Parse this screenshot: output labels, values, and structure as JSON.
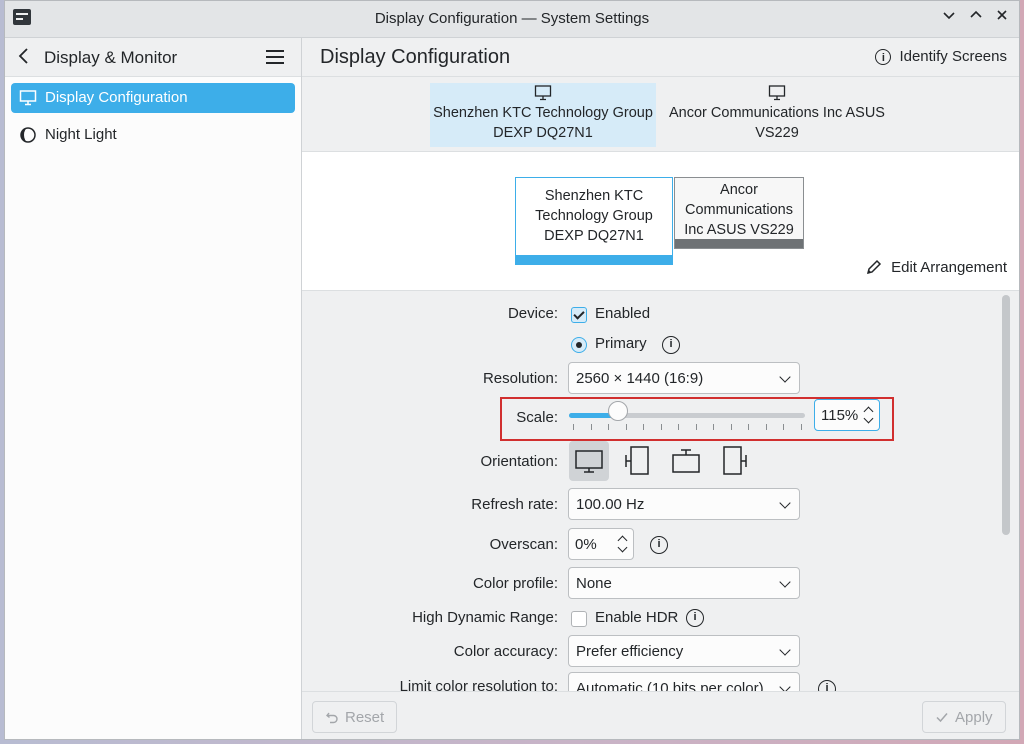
{
  "window": {
    "title": "Display Configuration — System Settings"
  },
  "sidebar": {
    "header": "Display & Monitor",
    "items": [
      {
        "label": "Display Configuration",
        "active": true,
        "icon": "monitor-icon"
      },
      {
        "label": "Night Light",
        "active": false,
        "icon": "night-light-icon"
      }
    ]
  },
  "main": {
    "title": "Display Configuration",
    "identify_label": "Identify Screens",
    "tabs": [
      {
        "line1": "Shenzhen KTC Technology Group",
        "line2": "DEXP DQ27N1",
        "selected": true
      },
      {
        "line1": "Ancor Communications Inc ASUS",
        "line2": "VS229",
        "selected": false
      }
    ],
    "arrangement": {
      "monitors": [
        {
          "lines": [
            "Shenzhen KTC",
            "Technology Group",
            "DEXP DQ27N1"
          ],
          "primary": true
        },
        {
          "lines": [
            "Ancor",
            "Communications",
            "Inc ASUS VS229"
          ],
          "primary": false
        }
      ],
      "edit_label": "Edit Arrangement"
    },
    "settings": {
      "device_label": "Device:",
      "enabled_label": "Enabled",
      "enabled": true,
      "primary_label": "Primary",
      "resolution_label": "Resolution:",
      "resolution_value": "2560 × 1440 (16:9)",
      "scale_label": "Scale:",
      "scale_value": "115%",
      "scale_fraction": 0.15,
      "orientation_label": "Orientation:",
      "refresh_label": "Refresh rate:",
      "refresh_value": "100.00 Hz",
      "overscan_label": "Overscan:",
      "overscan_value": "0%",
      "color_profile_label": "Color profile:",
      "color_profile_value": "None",
      "hdr_label": "High Dynamic Range:",
      "hdr_option": "Enable HDR",
      "hdr_enabled": false,
      "color_accuracy_label": "Color accuracy:",
      "color_accuracy_value": "Prefer efficiency",
      "limit_label": "Limit color resolution to:",
      "limit_value": "Automatic (10 bits per color)"
    },
    "footer": {
      "reset_label": "Reset",
      "apply_label": "Apply"
    }
  },
  "colors": {
    "accent": "#3daee9",
    "highlight_box": "#d12f2f"
  }
}
